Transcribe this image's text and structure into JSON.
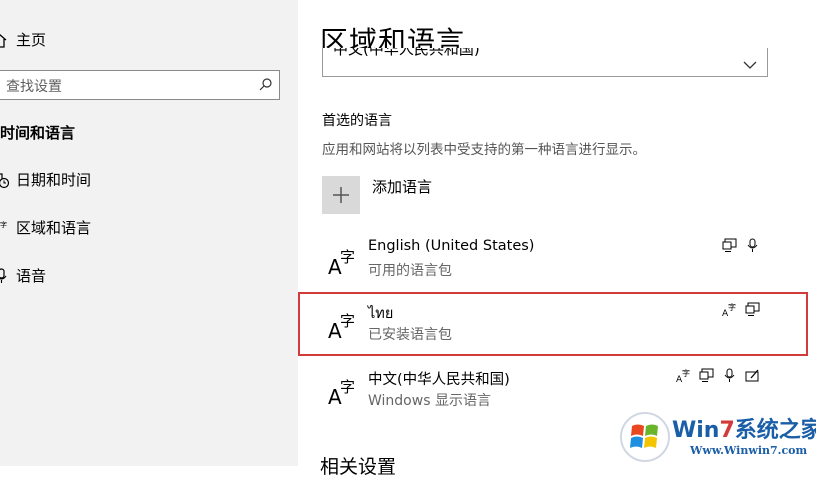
{
  "sidebar": {
    "home_label": "主页",
    "search_placeholder": "查找设置",
    "section_heading": "时间和语言",
    "items": [
      {
        "label": "日期和时间",
        "icon": "calendar-clock-icon"
      },
      {
        "label": "区域和语言",
        "icon": "region-language-icon"
      },
      {
        "label": "语音",
        "icon": "microphone-icon"
      }
    ]
  },
  "main": {
    "title": "区域和语言",
    "region_value": "中文(中华人民共和国)",
    "preferred_title": "首选的语言",
    "preferred_desc": "应用和网站将以列表中受支持的第一种语言进行显示。",
    "add_label": "添加语言",
    "languages": [
      {
        "name": "English (United States)",
        "status": "可用的语言包",
        "features": [
          "display-icon",
          "microphone-icon"
        ]
      },
      {
        "name": "ไทย",
        "status": "已安装语言包",
        "features": [
          "language-pack-icon",
          "display-icon"
        ]
      },
      {
        "name": "中文(中华人民共和国)",
        "status": "Windows 显示语言",
        "features": [
          "language-pack-icon",
          "display-icon",
          "microphone-icon",
          "handwriting-icon"
        ]
      }
    ],
    "related_heading": "相关设置"
  },
  "watermark": {
    "brand_prefix": "Win",
    "brand_num": "7",
    "brand_suffix": "系统之家",
    "url": "Www.Winwin7.com"
  },
  "colors": {
    "highlight": "#d33b3b",
    "sidebar_bg": "#f2f2f2",
    "accent": "#1b5ea8"
  }
}
